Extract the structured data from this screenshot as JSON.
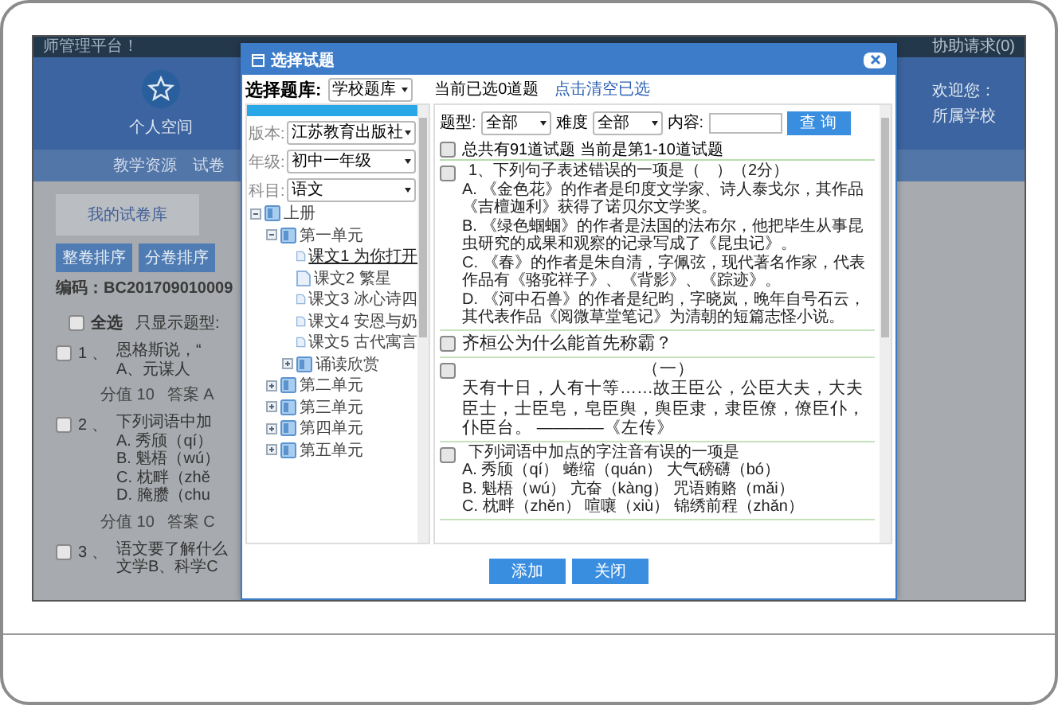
{
  "top_bar": {
    "title": "师管理平台！",
    "help": "协助请求(0)"
  },
  "header": {
    "space_label": "个人空间",
    "welcome": "欢迎您：",
    "school": "所属学校"
  },
  "nav": [
    "教学资源",
    "试卷"
  ],
  "library_tab": "我的试卷库",
  "sort_buttons": [
    "整卷排序",
    "分卷排序"
  ],
  "code": "编码：BC201709010009",
  "select_all": {
    "label": "全选",
    "checked": false
  },
  "type_filter_label": "只显示题型:",
  "questions": [
    {
      "number": "1 、",
      "checked": false,
      "lines": [
        "恩格斯说，“",
        "A、元谋人"
      ],
      "score": "分值 10",
      "answer": "答案 A"
    },
    {
      "number": "2 、",
      "checked": false,
      "lines": [
        "下列词语中加",
        "A. 秀颀（qí）",
        "B. 魁梧（wú）",
        "C. 枕畔（zhě",
        "D. 腌臜（chu"
      ],
      "score": "分值 10",
      "answer": "答案 C"
    },
    {
      "number": "3 、",
      "checked": false,
      "lines": [
        "语文要了解什么",
        "文学B、科学C"
      ]
    }
  ],
  "dialog": {
    "title": "选择试题",
    "bank_label": "选择题库:",
    "bank": "学校题库",
    "selected_count": "当前已选0道题",
    "clear_link": "点击清空已选",
    "filters": [
      {
        "label": "版本:",
        "value": "江苏教育出版社"
      },
      {
        "label": "年级:",
        "value": "初中一年级"
      },
      {
        "label": "科目:",
        "value": "语文"
      }
    ],
    "tree": [
      {
        "label": "上册",
        "expanded": true,
        "children": [
          {
            "label": "第一单元",
            "expanded": true,
            "children": [
              {
                "label": "课文1 为你打开",
                "selected": true
              },
              {
                "label": "课文2 繁星",
                "selected": false
              },
              {
                "label": "课文3 冰心诗四",
                "selected": false
              },
              {
                "label": "课文4 安恩与奶",
                "selected": false
              },
              {
                "label": "课文5 古代寓言",
                "selected": false
              },
              {
                "label": "诵读欣赏",
                "expanded": false
              }
            ]
          },
          {
            "label": "第二单元",
            "expanded": false
          },
          {
            "label": "第三单元",
            "expanded": false
          },
          {
            "label": "第四单元",
            "expanded": false
          },
          {
            "label": "第五单元",
            "expanded": false
          }
        ]
      }
    ],
    "search": {
      "type_label": "题型:",
      "type": "全部",
      "difficulty_label": "难度",
      "difficulty": "全部",
      "content_label": "内容:",
      "button": "查 询"
    },
    "summary": {
      "checked": false,
      "text": "总共有91道试题 当前是第1-10道试题"
    },
    "items": [
      {
        "kind": "choice",
        "checked": false,
        "lines": [
          "1、下列句子表述错误的一项是（　）（2分）",
          "A. 《金色花》的作者是印度文学家、诗人泰戈尔，其作品《吉檀迦利》获得了诺贝尔文学奖。",
          "B. 《绿色蝈蝈》的作者是法国的法布尔，他把毕生从事昆虫研究的成果和观察的记录写成了《昆虫记》。",
          "C. 《春》的作者是朱自清，字佩弦，现代著名作家，代表作品有《骆驼祥子》、《背影》、《踪迹》。",
          "D. 《河中石兽》的作者是纪昀，字晓岚，晚年自号石云，其代表作品《阅微草堂笔记》为清朝的短篇志怪小说。"
        ]
      },
      {
        "kind": "question",
        "checked": false,
        "lines": [
          "齐桓公为什么能首先称霸？"
        ]
      },
      {
        "kind": "passage",
        "checked": false,
        "lines": [
          "（一）",
          "天有十日，人有十等……故王臣公，公臣大夫，大夫臣士，士臣皂，皂臣舆，舆臣隶，隶臣僚，僚臣仆，仆臣台。 ————《左传》"
        ]
      },
      {
        "kind": "choice",
        "checked": false,
        "lines": [
          "下列词语中加点的字注音有误的一项是",
          "A. 秀颀（qí） 蜷缩（quán） 大气磅礴（bó）",
          "B. 魁梧（wú） 亢奋（kàng） 咒语贿赂（mǎi）",
          "C. 枕畔（zhěn） 喧嚷（xiù） 锦绣前程（zhǎn）"
        ]
      }
    ],
    "buttons": [
      "添加",
      "关闭"
    ]
  }
}
